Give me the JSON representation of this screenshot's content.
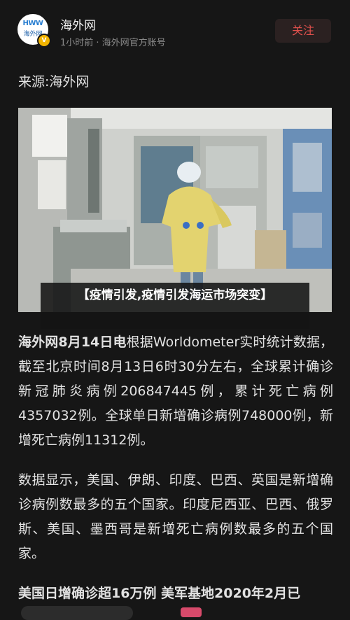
{
  "header": {
    "account_name": "海外网",
    "meta": "1小时前 · 海外网官方账号",
    "follow_label": "关注",
    "avatar_logo_top": "HWW",
    "avatar_logo_bottom": "海外网",
    "verified_mark": "V"
  },
  "article": {
    "source": "来源:海外网",
    "image_caption": "【疫情引发,疫情引发海运市场突变】",
    "p1_lead": "海外网8月14日电",
    "p1_rest": "根据Worldometer实时统计数据，截至北京时间8月13日6时30分左右，全球累计确诊新冠肺炎病例206847445例，累计死亡病例4357032例。全球单日新增确诊病例748000例，新增死亡病例11312例。",
    "p2": "数据显示，美国、伊朗、印度、巴西、英国是新增确诊病例数最多的五个国家。印度尼西亚、巴西、俄罗斯、美国、墨西哥是新增死亡病例数最多的五个国家。",
    "p3": "美国日增确诊超16万例 美军基地2020年2月已"
  }
}
